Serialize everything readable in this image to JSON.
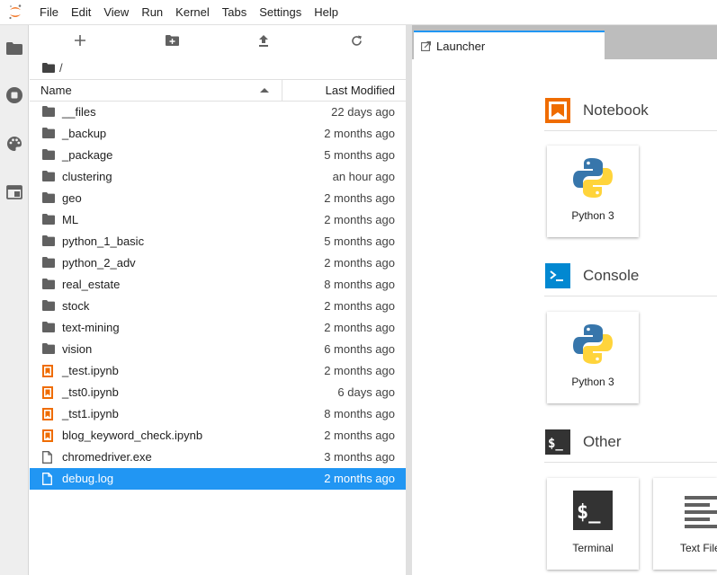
{
  "menubar": {
    "items": [
      "File",
      "Edit",
      "View",
      "Run",
      "Kernel",
      "Tabs",
      "Settings",
      "Help"
    ]
  },
  "filebrowser": {
    "breadcrumb": "/",
    "columns": {
      "name": "Name",
      "modified": "Last Modified"
    },
    "rows": [
      {
        "name": "__files",
        "modified": "22 days ago",
        "type": "folder"
      },
      {
        "name": "_backup",
        "modified": "2 months ago",
        "type": "folder"
      },
      {
        "name": "_package",
        "modified": "5 months ago",
        "type": "folder"
      },
      {
        "name": "clustering",
        "modified": "an hour ago",
        "type": "folder"
      },
      {
        "name": "geo",
        "modified": "2 months ago",
        "type": "folder"
      },
      {
        "name": "ML",
        "modified": "2 months ago",
        "type": "folder"
      },
      {
        "name": "python_1_basic",
        "modified": "5 months ago",
        "type": "folder"
      },
      {
        "name": "python_2_adv",
        "modified": "2 months ago",
        "type": "folder"
      },
      {
        "name": "real_estate",
        "modified": "8 months ago",
        "type": "folder"
      },
      {
        "name": "stock",
        "modified": "2 months ago",
        "type": "folder"
      },
      {
        "name": "text-mining",
        "modified": "2 months ago",
        "type": "folder"
      },
      {
        "name": "vision",
        "modified": "6 months ago",
        "type": "folder"
      },
      {
        "name": "_test.ipynb",
        "modified": "2 months ago",
        "type": "notebook"
      },
      {
        "name": "_tst0.ipynb",
        "modified": "6 days ago",
        "type": "notebook"
      },
      {
        "name": "_tst1.ipynb",
        "modified": "8 months ago",
        "type": "notebook"
      },
      {
        "name": "blog_keyword_check.ipynb",
        "modified": "2 months ago",
        "type": "notebook"
      },
      {
        "name": "chromedriver.exe",
        "modified": "3 months ago",
        "type": "file"
      },
      {
        "name": "debug.log",
        "modified": "2 months ago",
        "type": "file",
        "selected": true
      }
    ]
  },
  "main": {
    "tab": {
      "label": "Launcher"
    },
    "launcher": {
      "sections": [
        {
          "title": "Notebook",
          "icon": "notebook-icon",
          "cards": [
            {
              "label": "Python 3",
              "icon": "python-icon"
            }
          ]
        },
        {
          "title": "Console",
          "icon": "console-icon",
          "cards": [
            {
              "label": "Python 3",
              "icon": "python-icon"
            }
          ]
        },
        {
          "title": "Other",
          "icon": "other-icon",
          "cards": [
            {
              "label": "Terminal",
              "icon": "terminal-icon"
            },
            {
              "label": "Text File",
              "icon": "text-file-icon"
            }
          ]
        }
      ]
    }
  },
  "colors": {
    "accent": "#2196f3",
    "jupyter_orange": "#f37726",
    "folder": "#616161",
    "notebook_orange": "#ef6c00",
    "console_blue": "#0288d1",
    "terminal_dark": "#333333"
  }
}
